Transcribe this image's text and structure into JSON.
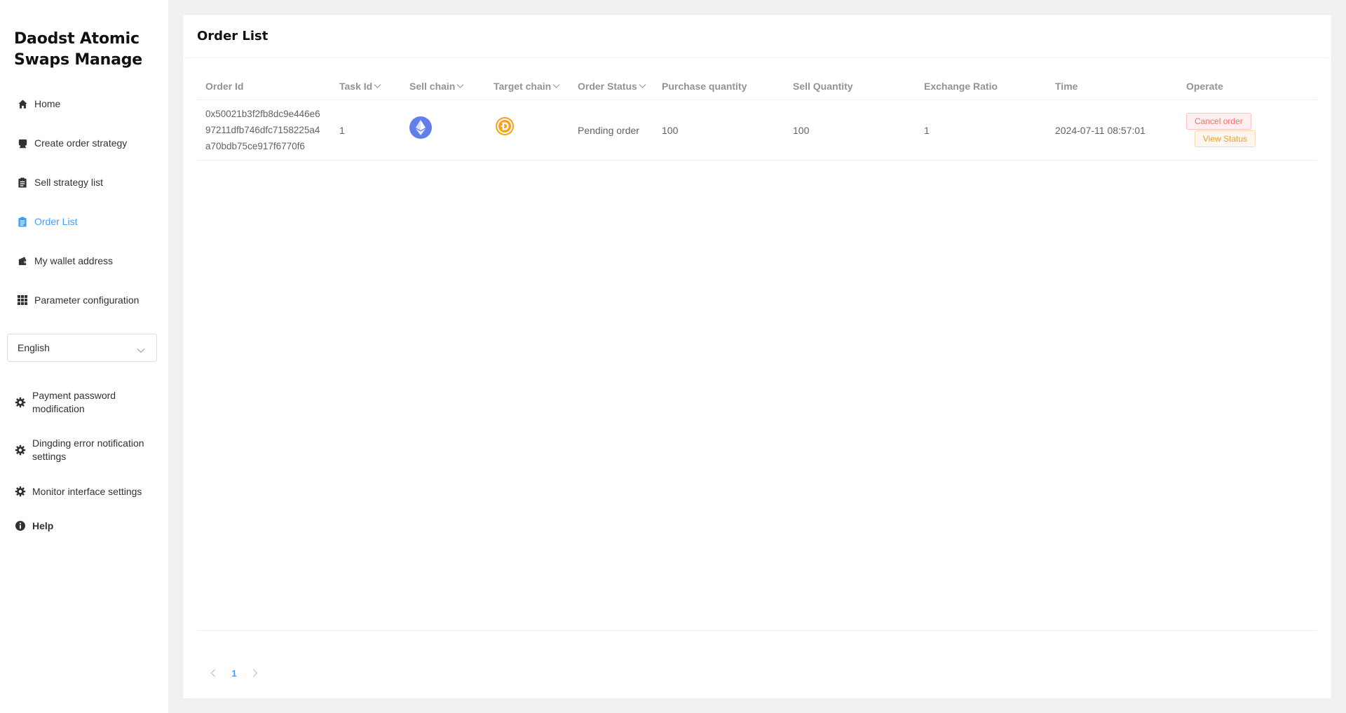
{
  "app": {
    "title": "Daodst Atomic Swaps Manage"
  },
  "sidebar": {
    "items": [
      {
        "label": "Home",
        "icon": "home-icon"
      },
      {
        "label": "Create order strategy",
        "icon": "strategy-icon"
      },
      {
        "label": "Sell strategy list",
        "icon": "clipboard-icon"
      },
      {
        "label": "Order List",
        "icon": "clipboard-icon",
        "active": true
      },
      {
        "label": "My wallet address",
        "icon": "wallet-icon"
      },
      {
        "label": "Parameter configuration",
        "icon": "grid-icon"
      }
    ],
    "language": {
      "value": "English"
    },
    "settings": [
      {
        "label": "Payment password modification",
        "icon": "gear-icon"
      },
      {
        "label": "Dingding error notification settings",
        "icon": "gear-icon"
      },
      {
        "label": "Monitor interface settings",
        "icon": "gear-icon"
      }
    ],
    "help": {
      "label": "Help",
      "icon": "info-icon"
    }
  },
  "main": {
    "title": "Order List",
    "table": {
      "columns": [
        "Order Id",
        "Task Id",
        "Sell chain",
        "Target chain",
        "Order Status",
        "Purchase quantity",
        "Sell Quantity",
        "Exchange Ratio",
        "Time",
        "Operate"
      ],
      "rows": [
        {
          "order_id": "0x50021b3f2fb8dc9e446e697211dfb746dfc7158225a4a70bdb75ce917f6770f6",
          "task_id": "1",
          "sell_chain": "ethereum-icon",
          "target_chain": "dst-coin-icon",
          "order_status": "Pending order",
          "purchase_quantity": "100",
          "sell_quantity": "100",
          "exchange_ratio": "1",
          "time": "2024-07-11 08:57:01",
          "cancel_label": "Cancel order",
          "view_label": "View Status"
        }
      ]
    },
    "pagination": {
      "current_page": "1"
    }
  },
  "colors": {
    "accent": "#409eff",
    "danger": "#f56c6c",
    "warning": "#e6a23c",
    "eth": "#627eea",
    "dst": "#f7a21a"
  }
}
